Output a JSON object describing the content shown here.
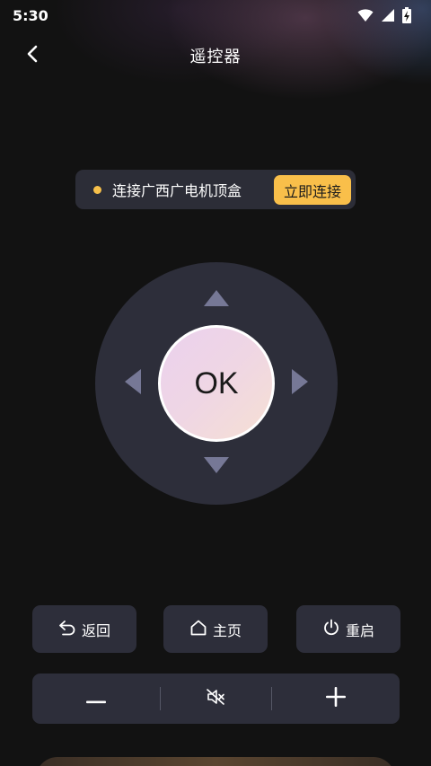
{
  "status_bar": {
    "time": "5:30",
    "icons": [
      "wifi-icon",
      "cell-signal-icon",
      "battery-charging-icon"
    ]
  },
  "header": {
    "back_icon": "chevron-left-icon",
    "title": "遥控器"
  },
  "connect": {
    "status_text": "连接广西广电机顶盒",
    "button_label": "立即连接",
    "dot_color": "#f7c04a",
    "button_color": "#f9bf4a"
  },
  "dpad": {
    "ok_label": "OK",
    "arrows": [
      "up",
      "down",
      "left",
      "right"
    ]
  },
  "controls": {
    "back_label": "返回",
    "home_label": "主页",
    "restart_label": "重启"
  },
  "volume": {
    "icons": [
      "minus-icon",
      "mute-icon",
      "plus-icon"
    ]
  },
  "colors": {
    "background": "#121212",
    "panel": "#2d2e3a",
    "arrow": "#767896"
  }
}
